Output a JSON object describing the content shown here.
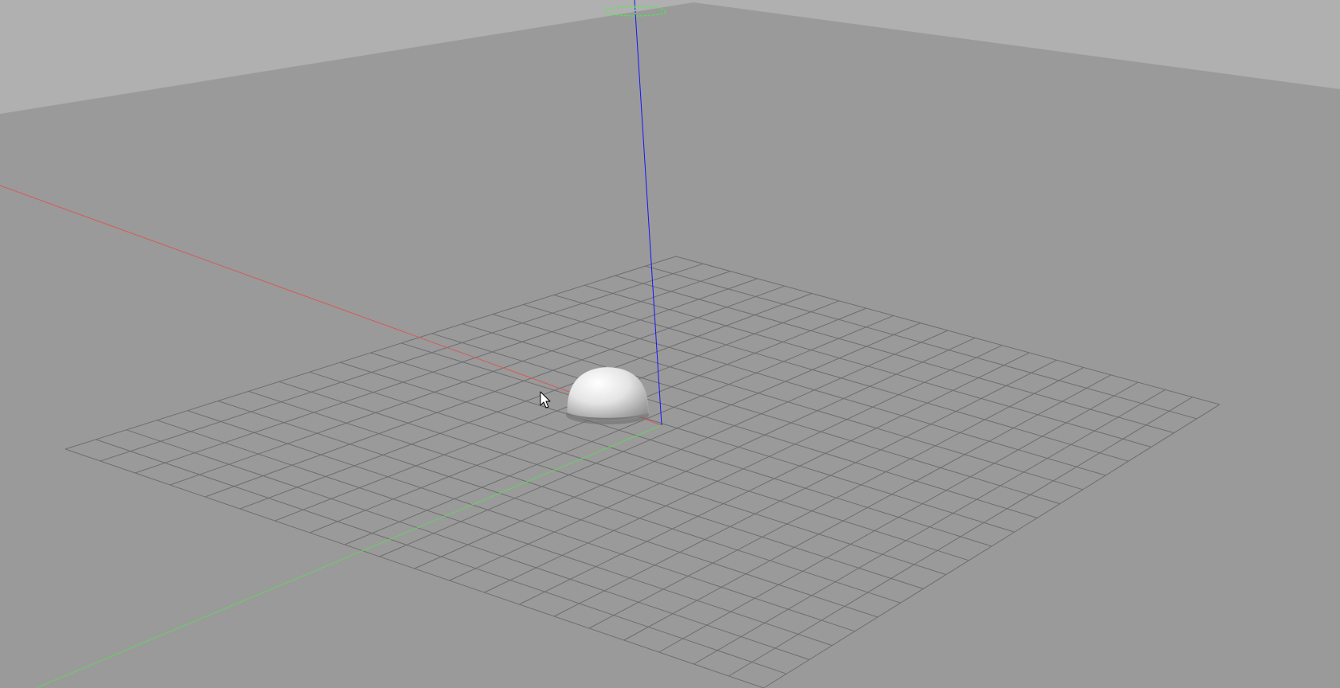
{
  "viewport": {
    "mode": "3d-perspective",
    "background_colors": {
      "horizon": "#b0b0b0",
      "floor": "#9a9a9a"
    },
    "ground_grid": {
      "divisions": 20,
      "line_color": "#6e6e6e"
    },
    "axes": {
      "x_color": "#d55a5a",
      "y_color": "#66d066",
      "z_color": "#1515ff"
    },
    "object": {
      "type": "hemisphere",
      "color": "#eeeeee"
    },
    "cursor": {
      "type": "arrow-pointer"
    }
  }
}
